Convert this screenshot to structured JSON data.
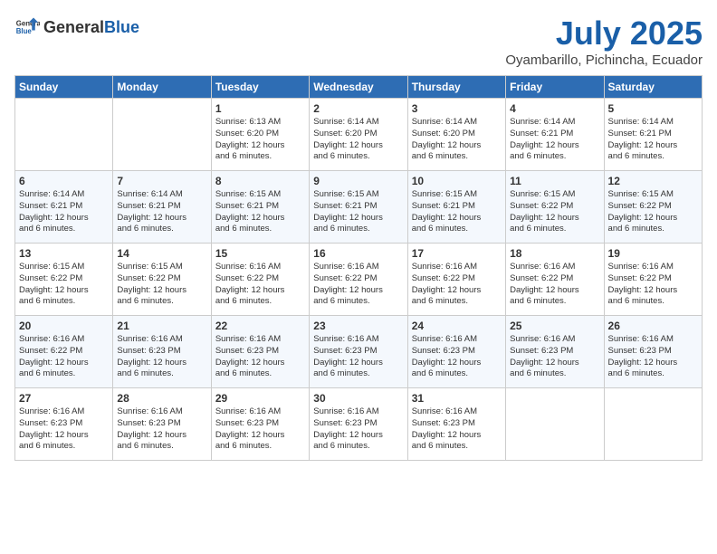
{
  "header": {
    "logo_general": "General",
    "logo_blue": "Blue",
    "month_year": "July 2025",
    "location": "Oyambarillo, Pichincha, Ecuador"
  },
  "days_of_week": [
    "Sunday",
    "Monday",
    "Tuesday",
    "Wednesday",
    "Thursday",
    "Friday",
    "Saturday"
  ],
  "weeks": [
    [
      {
        "day": "",
        "info": ""
      },
      {
        "day": "",
        "info": ""
      },
      {
        "day": "1",
        "info": "Sunrise: 6:13 AM\nSunset: 6:20 PM\nDaylight: 12 hours\nand 6 minutes."
      },
      {
        "day": "2",
        "info": "Sunrise: 6:14 AM\nSunset: 6:20 PM\nDaylight: 12 hours\nand 6 minutes."
      },
      {
        "day": "3",
        "info": "Sunrise: 6:14 AM\nSunset: 6:20 PM\nDaylight: 12 hours\nand 6 minutes."
      },
      {
        "day": "4",
        "info": "Sunrise: 6:14 AM\nSunset: 6:21 PM\nDaylight: 12 hours\nand 6 minutes."
      },
      {
        "day": "5",
        "info": "Sunrise: 6:14 AM\nSunset: 6:21 PM\nDaylight: 12 hours\nand 6 minutes."
      }
    ],
    [
      {
        "day": "6",
        "info": "Sunrise: 6:14 AM\nSunset: 6:21 PM\nDaylight: 12 hours\nand 6 minutes."
      },
      {
        "day": "7",
        "info": "Sunrise: 6:14 AM\nSunset: 6:21 PM\nDaylight: 12 hours\nand 6 minutes."
      },
      {
        "day": "8",
        "info": "Sunrise: 6:15 AM\nSunset: 6:21 PM\nDaylight: 12 hours\nand 6 minutes."
      },
      {
        "day": "9",
        "info": "Sunrise: 6:15 AM\nSunset: 6:21 PM\nDaylight: 12 hours\nand 6 minutes."
      },
      {
        "day": "10",
        "info": "Sunrise: 6:15 AM\nSunset: 6:21 PM\nDaylight: 12 hours\nand 6 minutes."
      },
      {
        "day": "11",
        "info": "Sunrise: 6:15 AM\nSunset: 6:22 PM\nDaylight: 12 hours\nand 6 minutes."
      },
      {
        "day": "12",
        "info": "Sunrise: 6:15 AM\nSunset: 6:22 PM\nDaylight: 12 hours\nand 6 minutes."
      }
    ],
    [
      {
        "day": "13",
        "info": "Sunrise: 6:15 AM\nSunset: 6:22 PM\nDaylight: 12 hours\nand 6 minutes."
      },
      {
        "day": "14",
        "info": "Sunrise: 6:15 AM\nSunset: 6:22 PM\nDaylight: 12 hours\nand 6 minutes."
      },
      {
        "day": "15",
        "info": "Sunrise: 6:16 AM\nSunset: 6:22 PM\nDaylight: 12 hours\nand 6 minutes."
      },
      {
        "day": "16",
        "info": "Sunrise: 6:16 AM\nSunset: 6:22 PM\nDaylight: 12 hours\nand 6 minutes."
      },
      {
        "day": "17",
        "info": "Sunrise: 6:16 AM\nSunset: 6:22 PM\nDaylight: 12 hours\nand 6 minutes."
      },
      {
        "day": "18",
        "info": "Sunrise: 6:16 AM\nSunset: 6:22 PM\nDaylight: 12 hours\nand 6 minutes."
      },
      {
        "day": "19",
        "info": "Sunrise: 6:16 AM\nSunset: 6:22 PM\nDaylight: 12 hours\nand 6 minutes."
      }
    ],
    [
      {
        "day": "20",
        "info": "Sunrise: 6:16 AM\nSunset: 6:22 PM\nDaylight: 12 hours\nand 6 minutes."
      },
      {
        "day": "21",
        "info": "Sunrise: 6:16 AM\nSunset: 6:23 PM\nDaylight: 12 hours\nand 6 minutes."
      },
      {
        "day": "22",
        "info": "Sunrise: 6:16 AM\nSunset: 6:23 PM\nDaylight: 12 hours\nand 6 minutes."
      },
      {
        "day": "23",
        "info": "Sunrise: 6:16 AM\nSunset: 6:23 PM\nDaylight: 12 hours\nand 6 minutes."
      },
      {
        "day": "24",
        "info": "Sunrise: 6:16 AM\nSunset: 6:23 PM\nDaylight: 12 hours\nand 6 minutes."
      },
      {
        "day": "25",
        "info": "Sunrise: 6:16 AM\nSunset: 6:23 PM\nDaylight: 12 hours\nand 6 minutes."
      },
      {
        "day": "26",
        "info": "Sunrise: 6:16 AM\nSunset: 6:23 PM\nDaylight: 12 hours\nand 6 minutes."
      }
    ],
    [
      {
        "day": "27",
        "info": "Sunrise: 6:16 AM\nSunset: 6:23 PM\nDaylight: 12 hours\nand 6 minutes."
      },
      {
        "day": "28",
        "info": "Sunrise: 6:16 AM\nSunset: 6:23 PM\nDaylight: 12 hours\nand 6 minutes."
      },
      {
        "day": "29",
        "info": "Sunrise: 6:16 AM\nSunset: 6:23 PM\nDaylight: 12 hours\nand 6 minutes."
      },
      {
        "day": "30",
        "info": "Sunrise: 6:16 AM\nSunset: 6:23 PM\nDaylight: 12 hours\nand 6 minutes."
      },
      {
        "day": "31",
        "info": "Sunrise: 6:16 AM\nSunset: 6:23 PM\nDaylight: 12 hours\nand 6 minutes."
      },
      {
        "day": "",
        "info": ""
      },
      {
        "day": "",
        "info": ""
      }
    ]
  ]
}
